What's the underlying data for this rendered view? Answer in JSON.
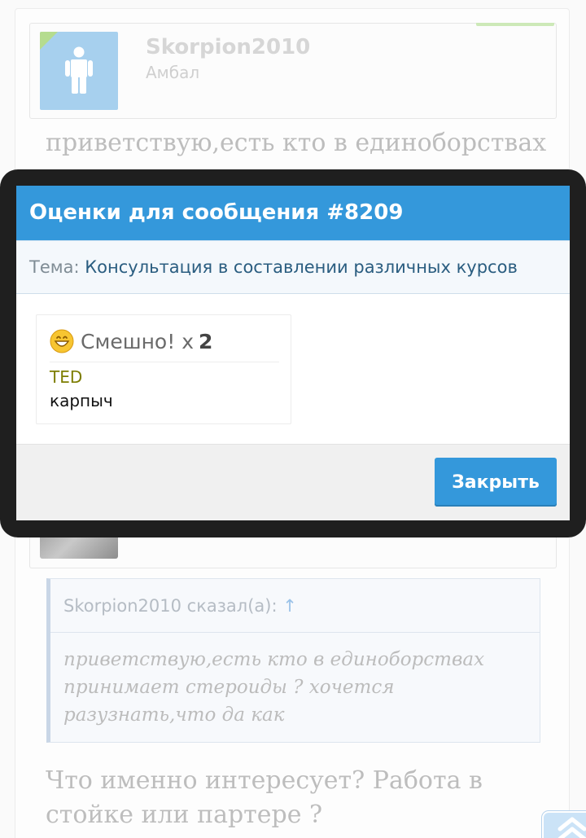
{
  "background": {
    "author": {
      "name": "Skorpion2010",
      "title": "Амбал"
    },
    "post_text": "приветствую,есть кто в единоборствах",
    "quote": {
      "header": "Skorpion2010 сказал(а):",
      "arrow": "↑",
      "body": "приветствую,есть кто в единоборствах принимает стероиды ? хочется разузнать,что да как"
    },
    "reply_text": "Что именно интересует? Работа в стойке или партере ?",
    "scroll_top_icon": "double-chevron-up-icon"
  },
  "dialog": {
    "title": "Оценки для сообщения #8209",
    "topic_label": "Тема:",
    "topic_value": "Консультация в составлении различных курсов",
    "rating": {
      "icon": "smiley-icon",
      "label": "Смешно!",
      "multiplier": "x",
      "count": "2",
      "raters": [
        "TED",
        "карпыч"
      ]
    },
    "close_label": "Закрыть"
  },
  "colors": {
    "accent": "#3498db",
    "overlay_frame": "#1f1f1f",
    "rater_highlight": "#7d7d00"
  }
}
